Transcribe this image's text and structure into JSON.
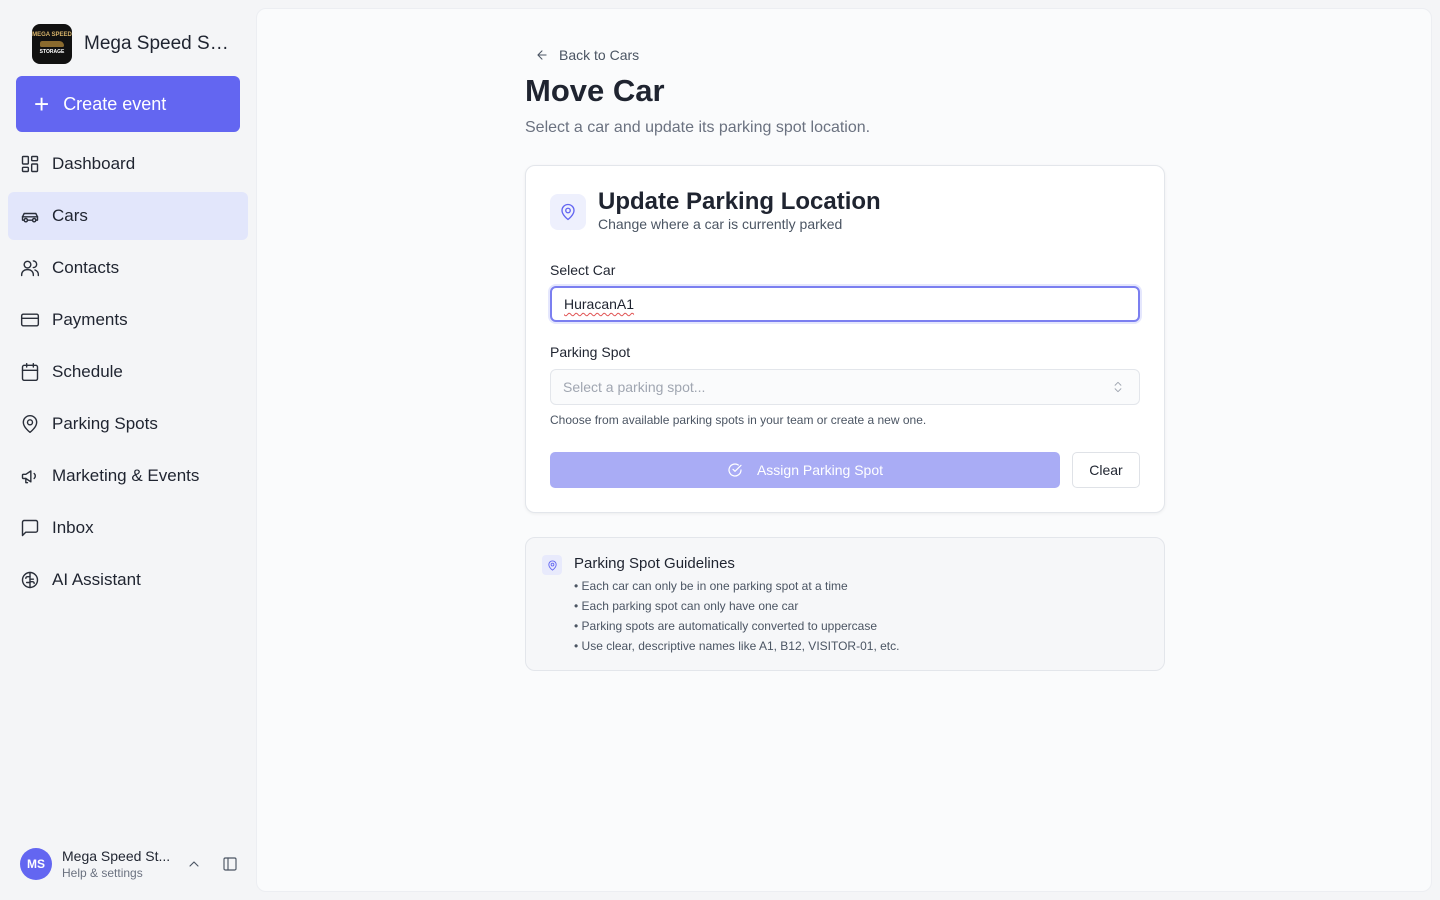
{
  "sidebar": {
    "brand_name": "Mega Speed St...",
    "logo_text_top": "MEGA SPEED",
    "logo_text_bottom": "STORAGE",
    "create_label": "Create event",
    "items": [
      {
        "label": "Dashboard",
        "icon": "dashboard-icon"
      },
      {
        "label": "Cars",
        "icon": "car-icon",
        "active": true
      },
      {
        "label": "Contacts",
        "icon": "users-icon"
      },
      {
        "label": "Payments",
        "icon": "credit-card-icon"
      },
      {
        "label": "Schedule",
        "icon": "calendar-icon"
      },
      {
        "label": "Parking Spots",
        "icon": "map-pin-icon"
      },
      {
        "label": "Marketing & Events",
        "icon": "megaphone-icon"
      },
      {
        "label": "Inbox",
        "icon": "message-square-icon"
      },
      {
        "label": "AI Assistant",
        "icon": "brain-icon"
      }
    ],
    "user": {
      "initials": "MS",
      "name": "Mega Speed St...",
      "subtitle": "Help & settings"
    }
  },
  "main": {
    "back_label": "Back to Cars",
    "title": "Move Car",
    "subtitle": "Select a car and update its parking spot location.",
    "card": {
      "title": "Update Parking Location",
      "subtitle": "Change where a car is currently parked",
      "select_car_label": "Select Car",
      "select_car_value": "HuracanA1",
      "parking_spot_label": "Parking Spot",
      "parking_spot_placeholder": "Select a parking spot...",
      "helper": "Choose from available parking spots in your team or create a new one.",
      "assign_label": "Assign Parking Spot",
      "clear_label": "Clear"
    },
    "guidelines": {
      "title": "Parking Spot Guidelines",
      "items": [
        "• Each car can only be in one parking spot at a time",
        "• Each parking spot can only have one car",
        "• Parking spots are automatically converted to uppercase",
        "• Use clear, descriptive names like A1, B12, VISITOR-01, etc."
      ]
    }
  },
  "colors": {
    "accent": "#6366f1",
    "active_nav_bg": "#e2e6fb",
    "disabled_button": "#a9acf5"
  }
}
